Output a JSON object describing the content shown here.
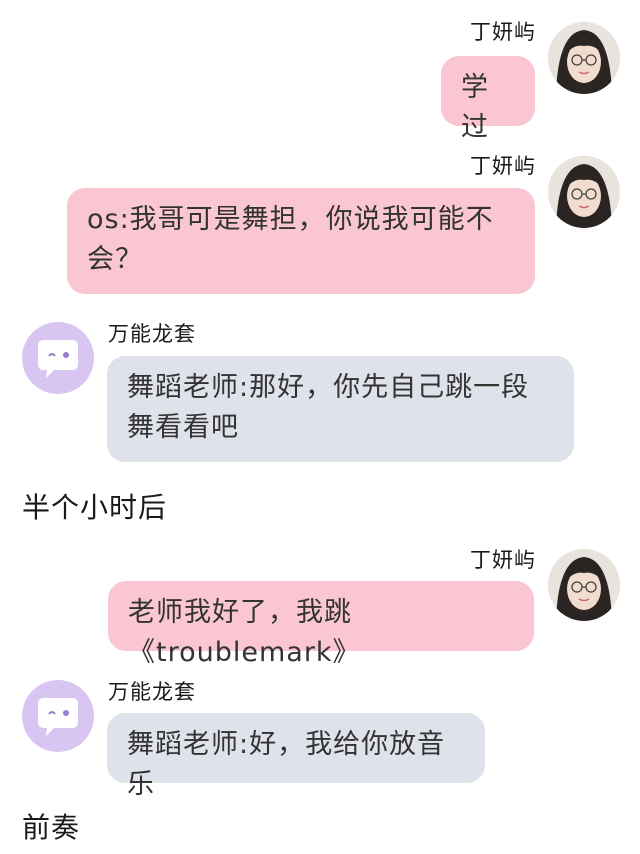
{
  "messages": [
    {
      "sender": "丁妍屿",
      "text": "学过"
    },
    {
      "sender": "丁妍屿",
      "text": "os:我哥可是舞担，你说我可能不会？"
    },
    {
      "sender": "万能龙套",
      "text": "舞蹈老师:那好，你先自己跳一段舞看看吧"
    },
    {
      "narration": "半个小时后"
    },
    {
      "sender": "丁妍屿",
      "text": "老师我好了，我跳《troublemark》"
    },
    {
      "sender": "万能龙套",
      "text": "舞蹈老师:好，我给你放音乐"
    },
    {
      "narration": "前奏"
    }
  ],
  "colors": {
    "user_bubble": "#f9c6d1",
    "bot_bubble": "#dfe2ea",
    "bot_avatar": "#d9c5f2"
  },
  "icons": {
    "user_avatar": "portrait-photo-icon",
    "bot_avatar": "chat-bubble-face-icon"
  }
}
